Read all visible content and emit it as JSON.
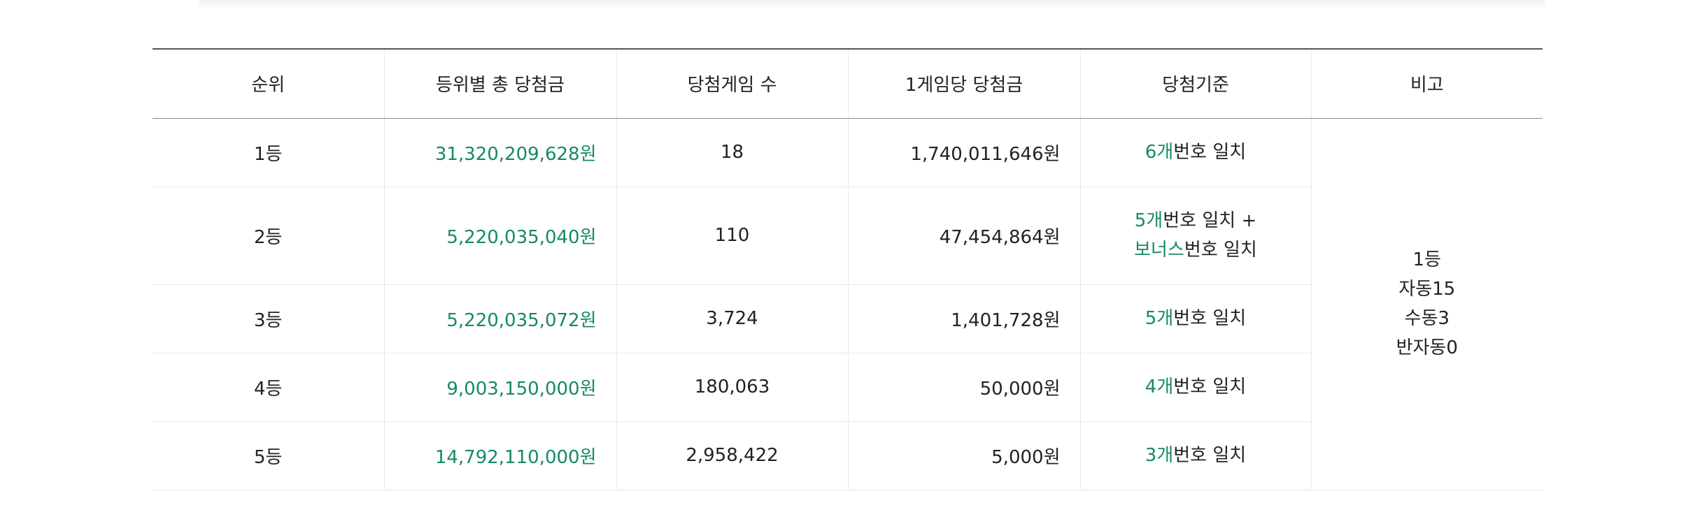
{
  "table": {
    "headers": [
      "순위",
      "등위별 총 당첨금",
      "당첨게임 수",
      "1게임당 당첨금",
      "당첨기준",
      "비고"
    ],
    "rows": [
      {
        "rank": "1등",
        "total": "31,320,209,628원",
        "winners": "18",
        "per_game": "1,740,011,646원",
        "criteria": {
          "line1_num": "6개",
          "line1_rest": "번호 일치",
          "line2_num": "",
          "line2_rest": ""
        }
      },
      {
        "rank": "2등",
        "total": "5,220,035,040원",
        "winners": "110",
        "per_game": "47,454,864원",
        "criteria": {
          "line1_num": "5개",
          "line1_rest": "번호 일치 +",
          "line2_num": "보너스",
          "line2_rest": "번호 일치"
        }
      },
      {
        "rank": "3등",
        "total": "5,220,035,072원",
        "winners": "3,724",
        "per_game": "1,401,728원",
        "criteria": {
          "line1_num": "5개",
          "line1_rest": "번호 일치",
          "line2_num": "",
          "line2_rest": ""
        }
      },
      {
        "rank": "4등",
        "total": "9,003,150,000원",
        "winners": "180,063",
        "per_game": "50,000원",
        "criteria": {
          "line1_num": "4개",
          "line1_rest": "번호 일치",
          "line2_num": "",
          "line2_rest": ""
        }
      },
      {
        "rank": "5등",
        "total": "14,792,110,000원",
        "winners": "2,958,422",
        "per_game": "5,000원",
        "criteria": {
          "line1_num": "3개",
          "line1_rest": "번호 일치",
          "line2_num": "",
          "line2_rest": ""
        }
      }
    ],
    "notes": [
      "1등",
      "자동15",
      "수동3",
      "반자동0"
    ]
  },
  "colors": {
    "accent_green": "#16896a",
    "text": "#222222",
    "header_rule": "#555555"
  }
}
